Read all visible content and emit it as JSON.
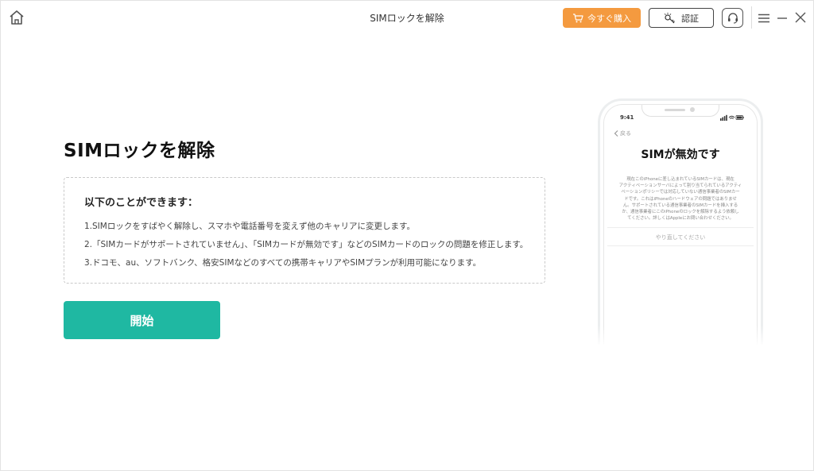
{
  "window": {
    "title": "SIMロックを解除",
    "buy_label": "今すぐ購入",
    "auth_label": "認証",
    "icons": {
      "home": "home-icon",
      "cart": "cart-icon",
      "key": "key-icon",
      "support": "headset-icon",
      "menu": "hamburger-menu-icon",
      "minimize": "minimize-icon",
      "close": "close-icon"
    },
    "colors": {
      "buy": "#f49a3f",
      "accent": "#1fb8a2"
    }
  },
  "main": {
    "title": "SIMロックを解除",
    "info_heading": "以下のことができます：",
    "features": [
      "1.SIMロックをすばやく解除し、スマホや電話番号を変えず他のキャリアに変更します。",
      "2.「SIMカードがサポートされていません」、「SIMカードが無効です」などのSIMカードのロックの問題を修正します。",
      "3.ドコモ、au、ソフトバンク、格安SIMなどのすべての携帯キャリアやSIMプランが利用可能になります。"
    ],
    "start_label": "開始"
  },
  "phone": {
    "time": "9:41",
    "back_label": "戻る",
    "title": "SIMが無効です",
    "body_lines": [
      "現在このiPhoneに差し込まれているSIMカードは、現在",
      "アクティベーションサーバによって割り当てられているアクティ",
      "ベーションポリシーでは対応していない通信事業者のSIMカー",
      "ドです。これはiPhoneのハードウェアの問題ではありませ",
      "ん。サポートされている通信事業者のSIMカードを挿入する",
      "か、通信事業者にこのiPhoneのロックを解除するよう依頼し",
      "てください。詳しくはAppleにお問い合わせください。"
    ],
    "retry_label": "やり直してください"
  }
}
